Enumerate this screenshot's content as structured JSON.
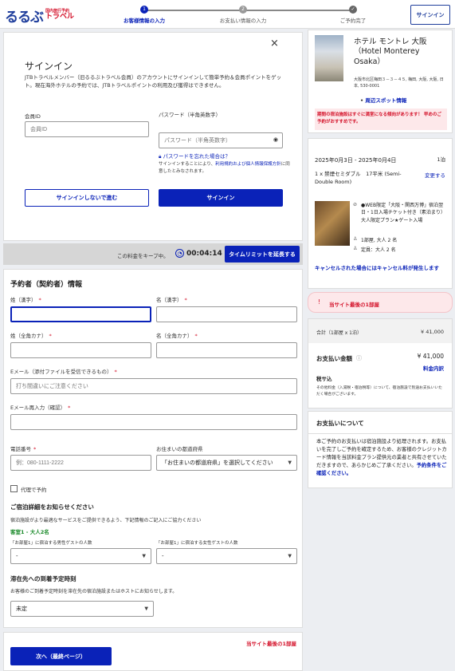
{
  "brand": {
    "main": "るるぶ",
    "sub_small": "国内旅行予約",
    "sub_large": "トラベル"
  },
  "steps": [
    {
      "number": "1",
      "label": "お客様情報の入力"
    },
    {
      "number": "2",
      "label": "お支払い情報の入力"
    },
    {
      "number": "✓",
      "label": "ご予約完了"
    }
  ],
  "header": {
    "signin_label": "サインイン"
  },
  "signin": {
    "close": "×",
    "title": "サインイン",
    "description": "JTBトラベルメンバー（旧るるぶトラベル会員）のアカウントにサインインして簡単予約＆会員ポイントをゲット。現在海外ホテルの予約では、JTBトラベルポイントの利用及び獲得はできません。",
    "member_id_label": "会員ID",
    "member_id_placeholder": "会員ID",
    "password_label": "パスワード（半角英数字）",
    "password_placeholder": "パスワード（半角英数字）",
    "forgot_link": "パスワードを忘れた場合は？",
    "terms_prefix": "サインインすることにより、",
    "terms_link": "利用規約および個人情報保護方針",
    "terms_suffix": "に同意したとみなされます。",
    "guest_button": "サインインしないで進む",
    "signin_button": "サインイン"
  },
  "timer": {
    "keep_text": "この料金をキープ中。",
    "time": "00:04:14",
    "extend_button": "タイムリミットを延長する"
  },
  "form": {
    "section_title": "予約者（契約者）情報",
    "last_name_kanji": "姓（漢字）",
    "first_name_kanji": "名（漢字）",
    "last_name_kana": "姓（全角カナ）",
    "first_name_kana": "名（全角カナ）",
    "email_label": "Eメール（添付ファイルを受信できるもの）",
    "email_placeholder": "打ち間違いにご注意ください",
    "email_confirm_label": "Eメール再入力（確認）",
    "phone_label": "電話番号",
    "phone_placeholder": "例：080-1111-2222",
    "prefecture_label": "お住まいの都道府県",
    "prefecture_value": "「お住まいの都道府県」を選択してください",
    "proxy_label": "代理で予約",
    "stay_title": "ご宿泊詳細をお知らせください",
    "stay_desc": "宿泊施設がより最適なサービスをご提供できるよう、下記情報のご記入にご協力ください",
    "room_label": "客室1 - 大人2名",
    "male_label": "「お部屋1」に宿泊する男性ゲストの人数",
    "female_label": "「お部屋1」に宿泊する女性ゲストの人数",
    "male_value": "-",
    "female_value": "-",
    "arrival_title": "滞在先への到着予定時刻",
    "arrival_desc": "お客様のご到着予定時刻を滞在先の宿泊施設またはホストにお知らせします。",
    "arrival_value": "未定"
  },
  "footer": {
    "last_room": "当サイト最後の1部屋",
    "next_button": "次へ（最終ページ）"
  },
  "hotel": {
    "name": "ホテル モントレ 大阪（Hotel Monterey Osaka）",
    "address": "大阪市北区梅田３－３－４５, 梅田, 大阪, 大阪, 日本, 530-0001",
    "nearby_link": "周辺スポット情報",
    "alert": "期間の宿泊施設はすぐに満室になる傾向があります！ 早めのご予約がおすすめです。"
  },
  "booking": {
    "dates": "2025年0月3日 - 2025年0月4日",
    "nights": "1泊",
    "room_desc": "1 x 禁煙セミダブル　17平米 (Semi-Double Room)",
    "change_link": "変更する",
    "plan": "●WEB限定「大阪・関西万博」宿泊翌日・1日入場チケット付き（素泊まり）大人限定プラン★ゲート入場",
    "rooms_guests": "1部屋, 大人 2 名",
    "capacity": "定員：大人 2 名",
    "cancel_text": "キャンセルされた場合にはキャンセル料が発生します"
  },
  "availability": {
    "text": "当サイト最後の1部屋"
  },
  "price": {
    "subtotal_label": "合計（1部屋 x 1泊）",
    "subtotal_value": "¥ 41,000",
    "total_label": "お支払い金額",
    "total_value": "¥ 41,000",
    "breakdown_link": "料金内訳",
    "tax_label": "税サ込",
    "note": "その他料金（入湯税・宿泊税等）について、宿泊施設で別途お支払いいただく場合がございます。"
  },
  "payment_info": {
    "title": "お支払いについて",
    "text": "本ご予約のお支払いは宿泊施設より処理されます。お支払いを完了しご予約を確定するため、お客様のクレジットカード情報を当該料金プラン提供元の業者と共有させていただきますので、あらかじめご了承ください。",
    "link": "予約条件をご確認ください。"
  },
  "colors": {
    "brand_blue": "#1f3e9c",
    "primary_button": "#0a22b8",
    "alert_red": "#d4122a",
    "green": "#1a8a2a"
  }
}
